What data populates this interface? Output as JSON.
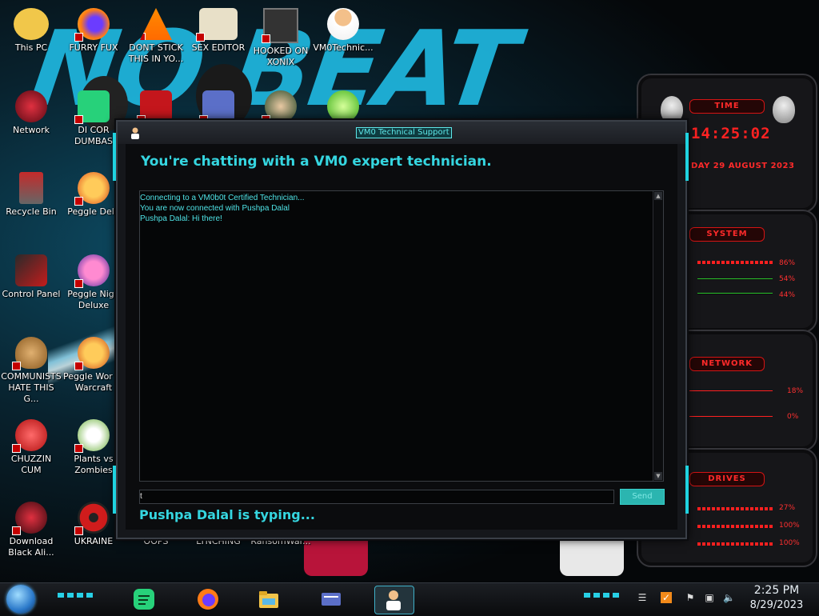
{
  "desktop": {
    "icons": [
      {
        "label": "This PC"
      },
      {
        "label": "FURRY FUX"
      },
      {
        "label": "DONT STICK THIS IN YO..."
      },
      {
        "label": "SEX EDITOR"
      },
      {
        "label": "HOOKED ON XONIX"
      },
      {
        "label": "VM0Technic..."
      },
      {
        "label": "Network"
      },
      {
        "label": "DI COR DUMBAS"
      },
      {
        "label": "Recycle Bin"
      },
      {
        "label": "Peggle Delu"
      },
      {
        "label": "Control Panel"
      },
      {
        "label": "Peggle Nigh Deluxe"
      },
      {
        "label": "COMMUNISTS HATE THIS G..."
      },
      {
        "label": "Peggle Wor of Warcraft"
      },
      {
        "label": "CHUZZIN CUM"
      },
      {
        "label": "Plants vs Zombies"
      },
      {
        "label": "Download Black Ali..."
      },
      {
        "label": "UKRAINE"
      },
      {
        "label": "OOPS"
      },
      {
        "label": "LYNCHING"
      },
      {
        "label": "RansomWar..."
      }
    ],
    "wallpaper_text": "NO BEAT"
  },
  "chat_window": {
    "title": "VM0 Technical Support",
    "heading": "You're chatting with a VM0 expert technician.",
    "log": [
      "Connecting to a VM0b0t Certified Technician...",
      "You are now connected with Pushpa Dalal",
      "Pushpa Dalal: Hi there!"
    ],
    "input_value": "t",
    "send_label": "Send",
    "status": "Pushpa Dalal is typing..."
  },
  "gadgets": {
    "time": {
      "title": "TIME",
      "clock": "14:25:02",
      "date": "DAY 29 AUGUST 2023"
    },
    "system": {
      "title": "SYSTEM",
      "values": [
        "86%",
        "54%",
        "44%"
      ]
    },
    "network": {
      "title": "NETWORK",
      "values": [
        "18%",
        "0%"
      ]
    },
    "drives": {
      "title": "DRIVES",
      "values": [
        "27%",
        "100%",
        "100%"
      ]
    }
  },
  "taskbar": {
    "time": "2:25 PM",
    "date": "8/29/2023"
  },
  "colors": {
    "accent": "#35d6e0",
    "gadget_red": "#ff2a2a"
  }
}
